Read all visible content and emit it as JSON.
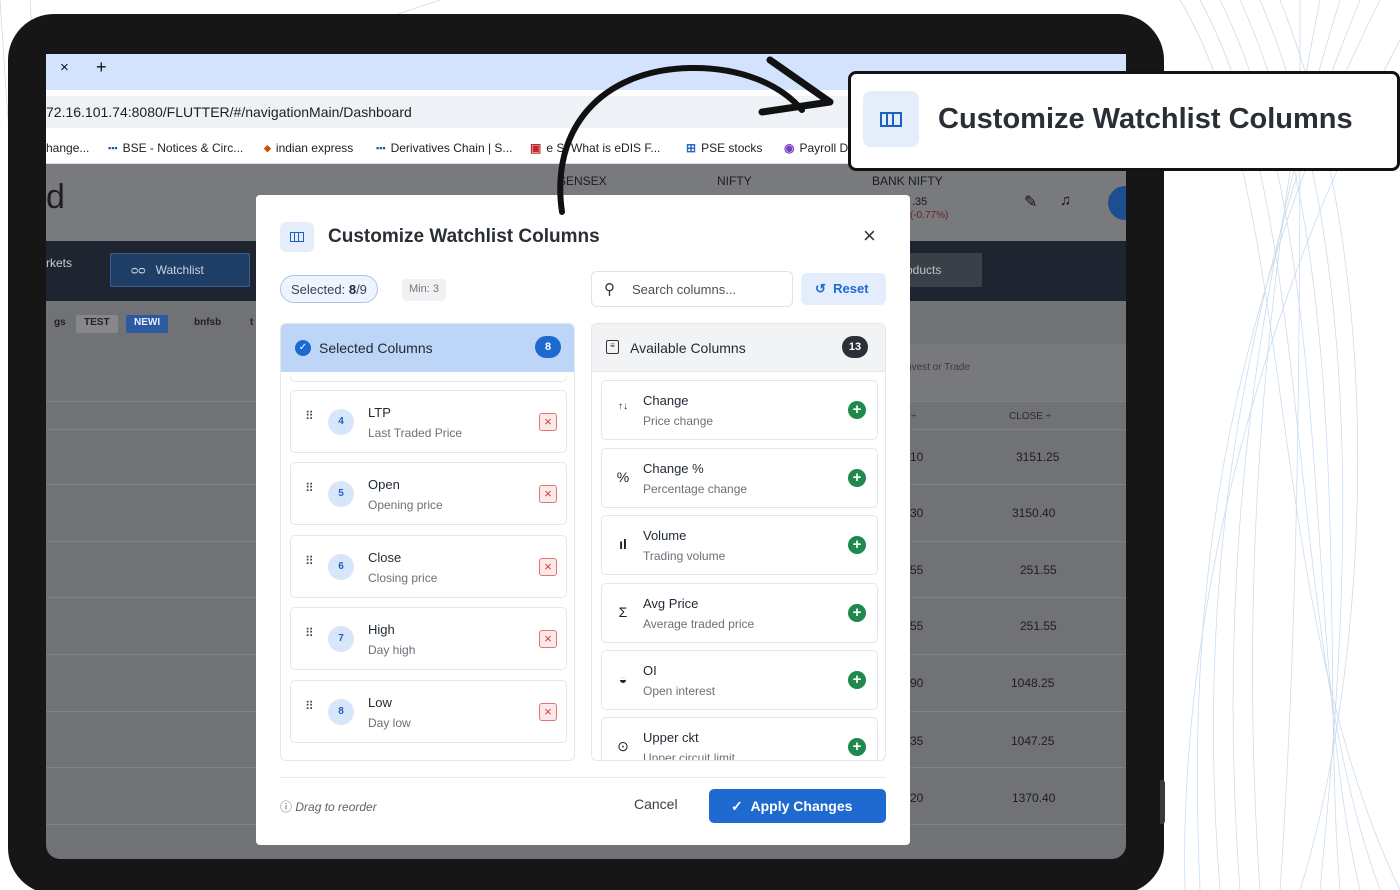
{
  "browser": {
    "tab_close": "×",
    "new_tab": "+",
    "url": "72.16.101.74:8080/FLUTTER/#/navigationMain/Dashboard",
    "bookmarks": [
      "hange...",
      "BSE - Notices & Circ...",
      "indian express",
      "Derivatives Chain | S...",
      "e  S: What is eDIS F...",
      "PSE stocks",
      "Payroll D"
    ]
  },
  "app": {
    "logo_fragment": "d",
    "indices": [
      {
        "name": "SENSEX"
      },
      {
        "name": "NIFTY"
      },
      {
        "name": "BANK NIFTY",
        "value": ".35",
        "change": "(-0.77%)"
      }
    ],
    "nav": {
      "markets": "rkets",
      "watchlist": "Watchlist",
      "products": "oducts"
    },
    "watchlist_tabs": [
      "gs",
      "TEST",
      "NEWI",
      "bnfsb",
      "t"
    ],
    "table": {
      "search_placeholder": "nvest or Trade",
      "col_prev": "÷",
      "col_close": "CLOSE ÷",
      "rows": [
        {
          "prev": "10",
          "close": "3151.25"
        },
        {
          "prev": "30",
          "close": "3150.40"
        },
        {
          "prev": "55",
          "close": "251.55"
        },
        {
          "prev": "55",
          "close": "251.55"
        },
        {
          "prev": "90",
          "close": "1048.25"
        },
        {
          "prev": "35",
          "close": "1047.25"
        },
        {
          "prev": "20",
          "close": "1370.40"
        }
      ]
    }
  },
  "modal": {
    "title": "Customize Watchlist Columns",
    "close": "×",
    "selected_label": "Selected:",
    "selected_value": "8",
    "selected_total": "/9",
    "min_label": "Min: 3",
    "search_placeholder": "Search columns...",
    "reset_label": "Reset",
    "selected_panel": {
      "title": "Selected Columns",
      "count": "8",
      "items": [
        {
          "num": "4",
          "title": "LTP",
          "sub": "Last Traded Price"
        },
        {
          "num": "5",
          "title": "Open",
          "sub": "Opening price"
        },
        {
          "num": "6",
          "title": "Close",
          "sub": "Closing price"
        },
        {
          "num": "7",
          "title": "High",
          "sub": "Day high"
        },
        {
          "num": "8",
          "title": "Low",
          "sub": "Day low"
        }
      ]
    },
    "available_panel": {
      "title": "Available Columns",
      "count": "13",
      "items": [
        {
          "icon": "↑↓",
          "title": "Change",
          "sub": "Price change"
        },
        {
          "icon": "%",
          "title": "Change %",
          "sub": "Percentage change"
        },
        {
          "icon": "ıl",
          "title": "Volume",
          "sub": "Trading volume"
        },
        {
          "icon": "Σ",
          "title": "Avg Price",
          "sub": "Average traded price"
        },
        {
          "icon": "◒",
          "title": "OI",
          "sub": "Open interest"
        },
        {
          "icon": "⊙",
          "title": "Upper ckt",
          "sub": "Upper circuit limit"
        }
      ]
    },
    "drag_hint": "Drag to reorder",
    "cancel_label": "Cancel",
    "apply_label": "Apply Changes"
  },
  "callout": {
    "title": "Customize Watchlist Columns"
  },
  "colors": {
    "accent": "#1f6ad0",
    "add": "#1f8a4c",
    "remove": "#d33333",
    "nav_dark": "#1e2530"
  }
}
